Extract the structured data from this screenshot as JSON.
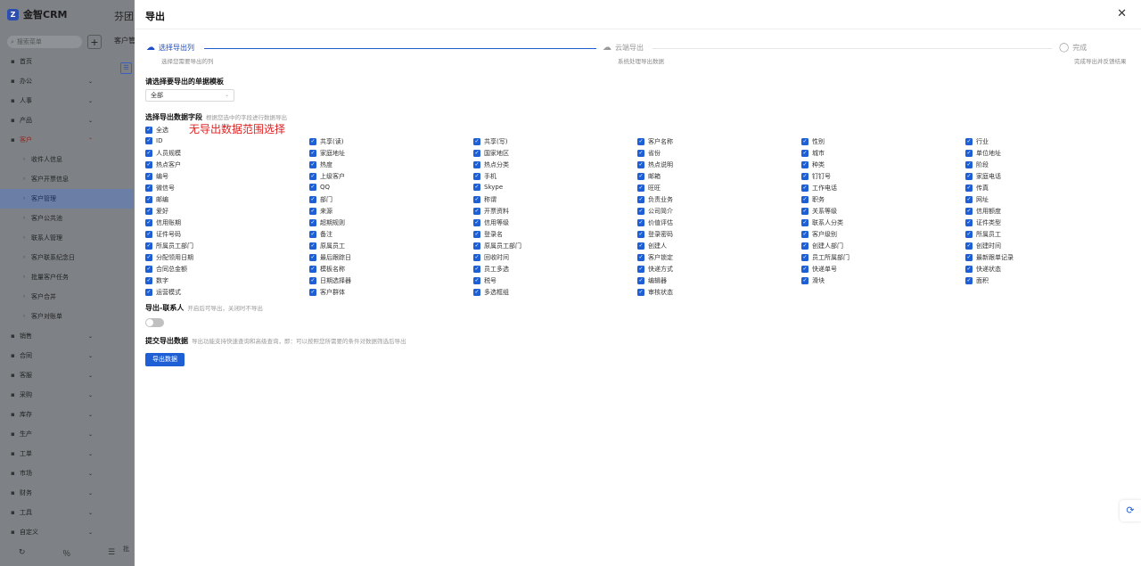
{
  "app": {
    "name": "金智CRM",
    "search_placeholder": "搜索菜单"
  },
  "sidebar": {
    "items": [
      {
        "label": "首页",
        "icon": "grid-icon"
      },
      {
        "label": "办公",
        "icon": "briefcase-icon",
        "chevron": "⌄"
      },
      {
        "label": "人事",
        "icon": "person-icon",
        "chevron": "⌄"
      },
      {
        "label": "产品",
        "icon": "box-icon",
        "chevron": "⌄"
      },
      {
        "label": "客户",
        "icon": "users-icon",
        "chevron": "⌃"
      },
      {
        "label": "收件人信息",
        "icon": "pin-icon",
        "sub": true
      },
      {
        "label": "客户开票信息",
        "icon": "invoice-icon",
        "sub": true
      },
      {
        "label": "客户管理",
        "icon": "people-icon",
        "sub": true,
        "active": true
      },
      {
        "label": "客户公共池",
        "icon": "pool-icon",
        "sub": true
      },
      {
        "label": "联系人管理",
        "icon": "contact-icon",
        "sub": true
      },
      {
        "label": "客户联系纪念日",
        "icon": "calendar-icon",
        "sub": true
      },
      {
        "label": "批量客户任务",
        "icon": "task-icon",
        "sub": true
      },
      {
        "label": "客户合并",
        "icon": "merge-icon",
        "sub": true
      },
      {
        "label": "客户对账单",
        "icon": "bill-icon",
        "sub": true
      },
      {
        "label": "销售",
        "icon": "sales-icon",
        "chevron": "⌄"
      },
      {
        "label": "合同",
        "icon": "contract-icon",
        "chevron": "⌄"
      },
      {
        "label": "客服",
        "icon": "service-icon",
        "chevron": "⌄"
      },
      {
        "label": "采购",
        "icon": "cart-icon",
        "chevron": "⌄"
      },
      {
        "label": "库存",
        "icon": "warehouse-icon",
        "chevron": "⌄"
      },
      {
        "label": "生产",
        "icon": "factory-icon",
        "chevron": "⌄"
      },
      {
        "label": "工单",
        "icon": "ticket-icon",
        "chevron": "⌄"
      },
      {
        "label": "市场",
        "icon": "market-icon",
        "chevron": "⌄"
      },
      {
        "label": "财务",
        "icon": "finance-icon",
        "chevron": "⌄"
      },
      {
        "label": "工具",
        "icon": "tool-icon",
        "chevron": "⌄"
      },
      {
        "label": "自定义",
        "icon": "custom-icon",
        "chevron": "⌄"
      }
    ],
    "bottom": [
      "↻",
      "％",
      "☰"
    ]
  },
  "background": {
    "title": "芬团",
    "subtitle": "客户管",
    "bottom": "批"
  },
  "drawer": {
    "title": "导出",
    "close": "✕",
    "steps": [
      {
        "title": "选择导出列",
        "desc": "选择您需要导出的列",
        "icon": "upload-cloud-icon",
        "state": "active"
      },
      {
        "title": "云端导出",
        "desc": "系统处理导出数据",
        "icon": "cloud-icon",
        "state": "pending"
      },
      {
        "title": "完成",
        "desc": "完成导出并反馈结果",
        "icon": "check-circle-icon",
        "state": "pending"
      }
    ],
    "template_label": "请选择要导出的单据模板",
    "template_value": "全部",
    "fields_label": "选择导出数据字段",
    "fields_hint": "根据您选中的字段进行数据导出",
    "red_note": "无导出数据范围选择",
    "select_all": "全选",
    "fields": [
      "ID",
      "共享(读)",
      "共享(写)",
      "客户名称",
      "性别",
      "行业",
      "人员规模",
      "家庭地址",
      "国家地区",
      "省份",
      "城市",
      "单位地址",
      "热点客户",
      "热度",
      "热点分类",
      "热点说明",
      "种类",
      "阶段",
      "编号",
      "上级客户",
      "手机",
      "邮箱",
      "钉钉号",
      "家庭电话",
      "微信号",
      "QQ",
      "Skype",
      "旺旺",
      "工作电话",
      "传真",
      "邮编",
      "部门",
      "称谓",
      "负责业务",
      "职务",
      "网址",
      "爱好",
      "来源",
      "开票资料",
      "公司简介",
      "关系等级",
      "信用额度",
      "信用账期",
      "超期规则",
      "信用等级",
      "价值评估",
      "联系人分类",
      "证件类型",
      "证件号码",
      "备注",
      "登录名",
      "登录密码",
      "客户级别",
      "所属员工",
      "所属员工部门",
      "原属员工",
      "原属员工部门",
      "创建人",
      "创建人部门",
      "创建时间",
      "分配领用日期",
      "最后跟踪日",
      "回收时间",
      "客户锁定",
      "员工所属部门",
      "最新跟单记录",
      "合同总金额",
      "模板名称",
      "员工多选",
      "快递方式",
      "快递单号",
      "快递状态",
      "数字",
      "日期选择器",
      "税号",
      "编辑器",
      "滑块",
      "面积",
      "运营模式",
      "客户群体",
      "多选框组",
      "审核状态"
    ],
    "contact_label": "导出-联系人",
    "contact_hint": "开启后可导出，关闭时不导出",
    "submit_label": "提交导出数据",
    "submit_hint": "导出功能支持快速查询和高级查询，即：可以按照您所需要的条件对数据筛选后导出",
    "export_button": "导出数据",
    "check": "✓"
  }
}
